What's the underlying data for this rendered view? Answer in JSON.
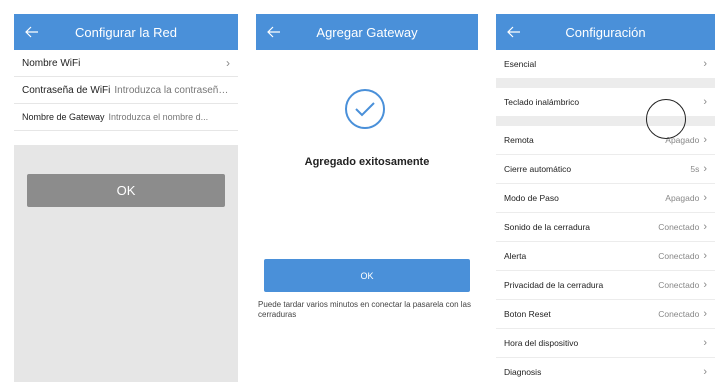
{
  "panel1": {
    "title": "Configurar la Red",
    "rows": [
      {
        "label": "Nombre WiFi",
        "placeholder": ""
      },
      {
        "label": "Contraseña de WiFi",
        "placeholder": "Introduzca la contraseña..."
      },
      {
        "label": "Nombre de Gateway",
        "placeholder": "Introduzca el nombre d..."
      }
    ],
    "ok_label": "OK"
  },
  "panel2": {
    "title": "Agregar Gateway",
    "success_text": "Agregado exitosamente",
    "ok_label": "OK",
    "note": "Puede tardar varios minutos en conectar la pasarela con las cerraduras"
  },
  "panel3": {
    "title": "Configuración",
    "items": [
      {
        "label": "Esencial",
        "value": ""
      },
      {
        "label": "Teclado inalámbrico",
        "value": ""
      },
      {
        "label": "Remota",
        "value": "Apagado"
      },
      {
        "label": "Cierre automático",
        "value": "5s"
      },
      {
        "label": "Modo de Paso",
        "value": "Apagado"
      },
      {
        "label": "Sonido de la cerradura",
        "value": "Conectado"
      },
      {
        "label": "Alerta",
        "value": "Conectado"
      },
      {
        "label": "Privacidad de la cerradura",
        "value": "Conectado"
      },
      {
        "label": "Boton Reset",
        "value": "Conectado"
      },
      {
        "label": "Hora del dispositivo",
        "value": ""
      },
      {
        "label": "Diagnosis",
        "value": ""
      }
    ]
  },
  "colors": {
    "header": "#4a90d9",
    "ok_gray": "#8c8c8c",
    "background_gray": "#e6e6e6"
  },
  "icons": {
    "back": "arrow-left-icon",
    "chevron": "chevron-right-icon",
    "success": "check-circle-icon"
  }
}
